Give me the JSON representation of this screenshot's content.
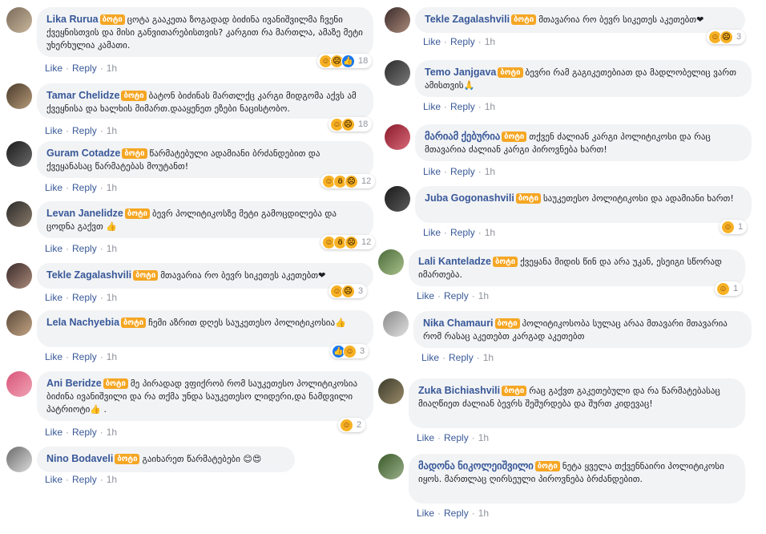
{
  "badge_label": "ბოტი",
  "actions": {
    "like": "Like",
    "reply": "Reply",
    "time": "1h"
  },
  "comments": [
    {
      "name": "Lika Rurua",
      "text": "ცოტა გააკეთა ზოგადად ბიძინა ივანიშვილმა ჩვენი ქვეყნისთვის და მისი განვითარებისთვის? კარგით რა მართლა, ამაზე მეტი უხერხულია კამათი.",
      "reactions": [
        "haha",
        "sad",
        "like"
      ],
      "count": "18"
    },
    {
      "name": "Tamar Chelidze",
      "text": "ბატონ ბიძინას მართლქც კარგი მიდგომა აქვს ამ ქვეყნისა და ხალხის მიმართ.დააყენეთ ეზები ნაცისტობო.",
      "reactions": [
        "haha",
        "sad"
      ],
      "count": "18"
    },
    {
      "name": "Guram Cotadze",
      "text": "წარმატებული ადამიანი ბრძანდებით და ქვეყანასაც წარმატებას მოუტანთ!",
      "reactions": [
        "haha",
        "wow",
        "sad"
      ],
      "count": "12"
    },
    {
      "name": "Levan Janelidze",
      "text": "ბევრ პოლიტიკოსზე მეტი გამოცდილება და ცოდნა გაქვთ 👍",
      "reactions": [
        "haha",
        "wow",
        "sad"
      ],
      "count": "12"
    },
    {
      "name": "Tekle Zagalashvili",
      "text": "მთავარია რო ბევრ სიკეთეს აკეთებთ❤",
      "reactions": [
        "haha",
        "sad"
      ],
      "count": "3"
    },
    {
      "name": "Lela Nachyebia",
      "text": "ჩემი აზრით დღეს საუკეთესო პოლიტიკოსია👍",
      "reactions": [
        "like",
        "haha"
      ],
      "count": "3"
    },
    {
      "name": "Ani Beridze",
      "text": "მე პირადად ვფიქრობ რომ საუკეთესო პოლიტიკოსია ბიძინა ივანიშვილი და რა თქმა უნდა საუკეთესო ლიდერი,და ნამდვილი პატრიოტი👍 .",
      "reactions": [
        "haha"
      ],
      "count": "2"
    },
    {
      "name": "Nino Bodaveli",
      "text": "გაიხარეთ წარმატებები 😊😍",
      "reactions": [],
      "count": ""
    },
    {
      "name": "Tekle Zagalashvili",
      "text": "მთავარია რო ბევრ სიკეთეს აკეთებთ❤",
      "reactions": [
        "haha",
        "sad"
      ],
      "count": "3"
    },
    {
      "name": "Temo Janjgava",
      "text": "ბევრი რამ გაგიკეთებიათ და მადლობელიც ვართ ამისთვის🙏",
      "reactions": [],
      "count": ""
    },
    {
      "name": "მარიამ ქებურია",
      "text": "თქვენ ძალიან კარგი პოლიტიკოსი და რაც მთავარია ძალიან კარგი პიროვნება ხართ!",
      "reactions": [],
      "count": ""
    },
    {
      "name": "Juba Gogonashvili",
      "text": "საუკეთესო პოლიტიკოსი და ადამიანი ხართ!",
      "reactions": [
        "haha"
      ],
      "count": "1"
    },
    {
      "name": "Lali Kanteladze",
      "text": "ქვეყანა მიდის წინ და არა უკან, ესეიგი სწორად იმართება.",
      "reactions": [
        "haha"
      ],
      "count": "1"
    },
    {
      "name": "Nika Chamauri",
      "text": "პოლიტიკოსობა სულაც არაა მთავარი მთავარია რომ რასაც აკეთებთ კარგად აკეთებთ",
      "reactions": [],
      "count": ""
    },
    {
      "name": "Zuka Bichiashvili",
      "text": "რაც გაქვთ გაკეთებული და რა წარმატებასაც მიაღწიეთ ძალიან ბევრს შეშურდება და შურთ კიდევაც!",
      "reactions": [],
      "count": ""
    },
    {
      "name": "მადონა ნიკოლეიშვილი",
      "text": "ნეტა ყველა თქვენნაირი პოლიტიკოსი იყოს. მართლაც ღირსეული პიროვნება ბრძანდებით.",
      "reactions": [],
      "count": ""
    }
  ]
}
